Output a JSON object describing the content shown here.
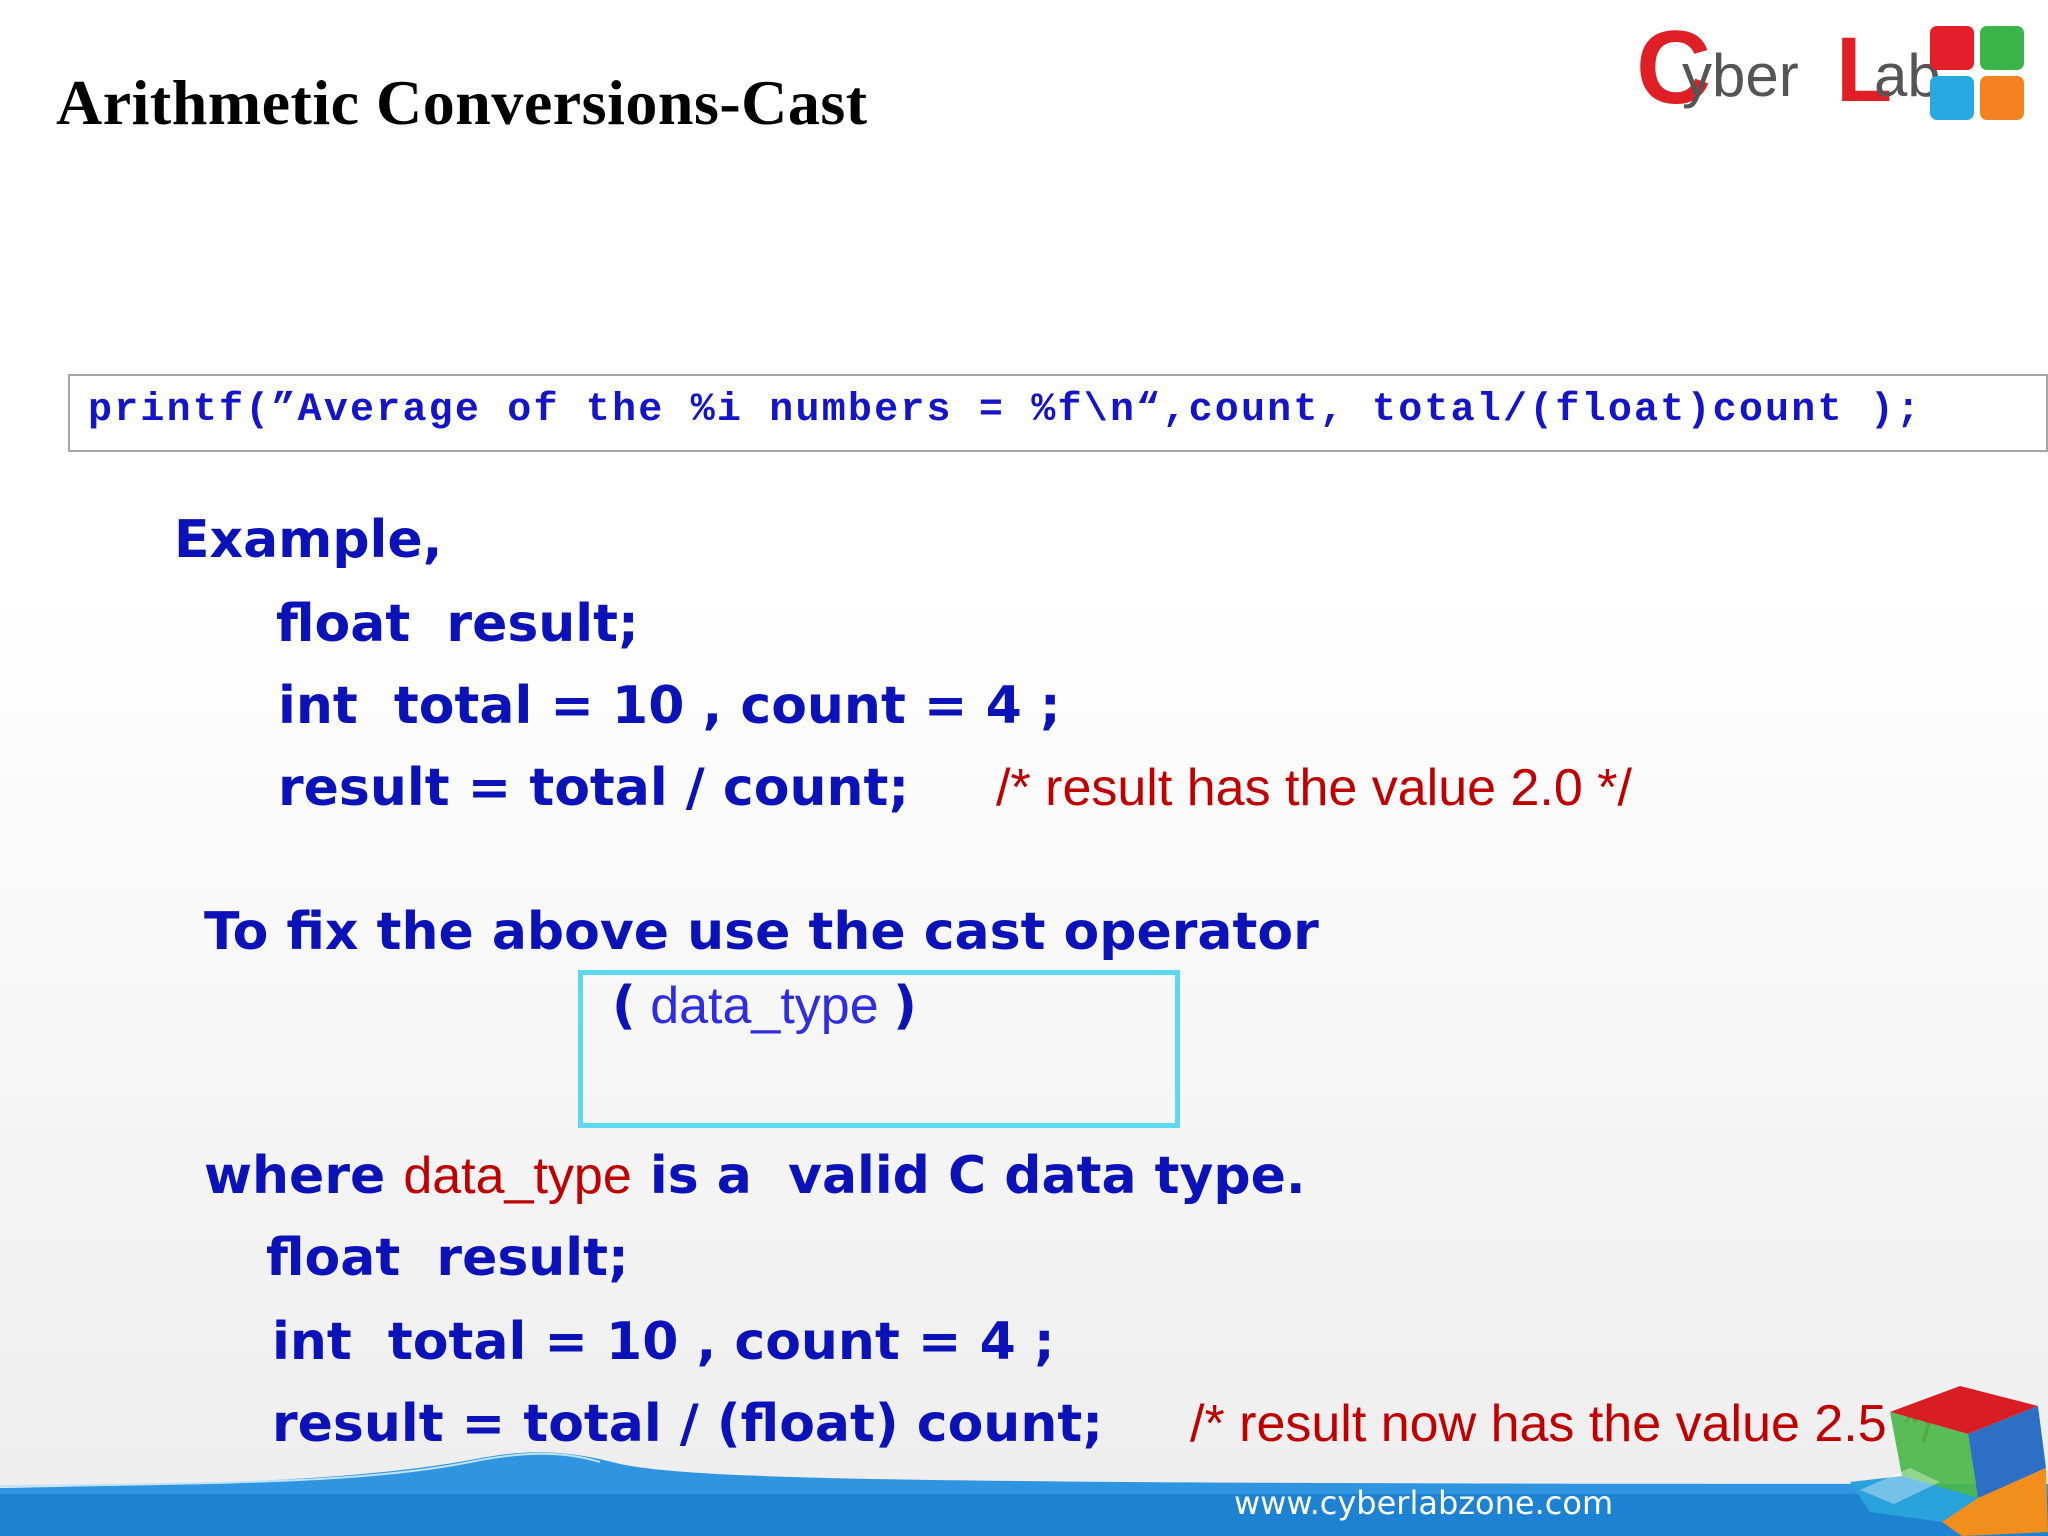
{
  "slide": {
    "title": "Arithmetic Conversions-Cast",
    "logo": {
      "c": "C",
      "yber": "yber",
      "l": "L",
      "ab": "ab",
      "colors": [
        "#e41e2b",
        "#3bb44a",
        "#27a9e1",
        "#f58220"
      ]
    },
    "printf_line": "printf(”Average of the %i numbers = %f\\n“,count, total/(float)count );",
    "example": {
      "heading": "Example,",
      "line1": "float  result;",
      "line2": "int  total = 10 , count = 4 ;",
      "line3": "result = total / count;",
      "line3_comment": "/* result has the value 2.0 */"
    },
    "fix_heading": "To fix the above use the cast operator",
    "cast": {
      "open_paren": "(",
      "data_type": " data_type ",
      "close_paren": ")"
    },
    "where": {
      "prefix": "where ",
      "data_type": "data_type",
      "suffix": " is a  valid C data type."
    },
    "fixed": {
      "line1": "float  result;",
      "line2": "int  total = 10 , count = 4 ;",
      "line3": "result = total / (float) count;",
      "line3_comment": "/* result now has the value 2.5 */"
    },
    "footer_url": "www.cyberlabzone.com",
    "colors": {
      "code_blue": "#0b13b8",
      "comment_red": "#c00000",
      "cast_box_cyan": "#5ed8ef",
      "footer_blue": "#1e82d2"
    }
  }
}
